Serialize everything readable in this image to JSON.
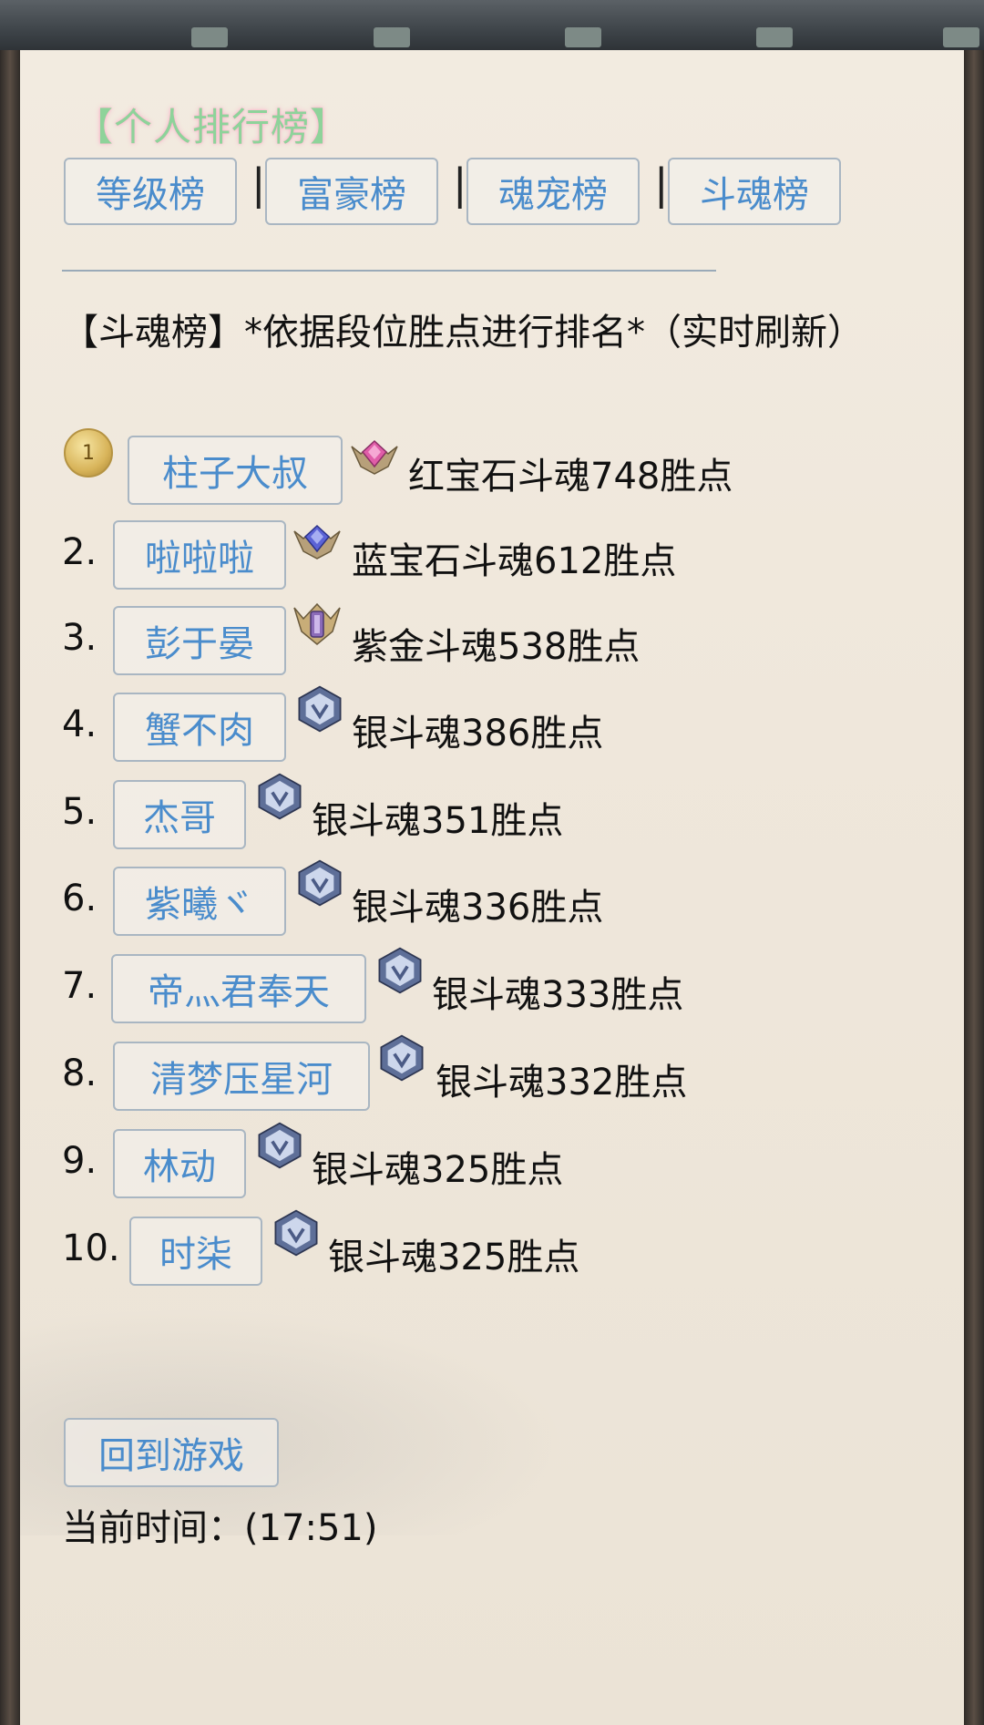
{
  "page": {
    "section_title": "【个人排行榜】",
    "tabs": [
      {
        "label": "等级榜"
      },
      {
        "label": "富豪榜"
      },
      {
        "label": "魂宠榜"
      },
      {
        "label": "斗魂榜"
      }
    ],
    "separator": "|",
    "heading": "【斗魂榜】*依据段位胜点进行排名*（实时刷新）",
    "rank1_medal_text": "1",
    "rankings": [
      {
        "number": "",
        "name": "柱子大叔",
        "rank_icon": "ruby-rank-icon",
        "desc": "红宝石斗魂748胜点"
      },
      {
        "number": "2.",
        "name": "啦啦啦",
        "rank_icon": "sapphire-rank-icon",
        "desc": "蓝宝石斗魂612胜点"
      },
      {
        "number": "3.",
        "name": "彭于晏",
        "rank_icon": "purple-gold-rank-icon",
        "desc": "紫金斗魂538胜点"
      },
      {
        "number": "4.",
        "name": "蟹不肉",
        "rank_icon": "silver-rank-icon",
        "desc": "银斗魂386胜点"
      },
      {
        "number": "5.",
        "name": "杰哥",
        "rank_icon": "silver-rank-icon",
        "desc": "银斗魂351胜点"
      },
      {
        "number": "6.",
        "name": "紫曦ヾ",
        "rank_icon": "silver-rank-icon",
        "desc": "银斗魂336胜点"
      },
      {
        "number": "7.",
        "name": "帝灬君奉天",
        "rank_icon": "silver-rank-icon",
        "desc": "银斗魂333胜点"
      },
      {
        "number": "8.",
        "name": "清梦压星河",
        "rank_icon": "silver-rank-icon",
        "desc": "银斗魂332胜点"
      },
      {
        "number": "9.",
        "name": "林动",
        "rank_icon": "silver-rank-icon",
        "desc": "银斗魂325胜点"
      },
      {
        "number": "10.",
        "name": "时柒",
        "rank_icon": "silver-rank-icon",
        "desc": "银斗魂325胜点"
      }
    ],
    "back_button": "回到游戏",
    "current_time": "当前时间：(17:51)"
  }
}
